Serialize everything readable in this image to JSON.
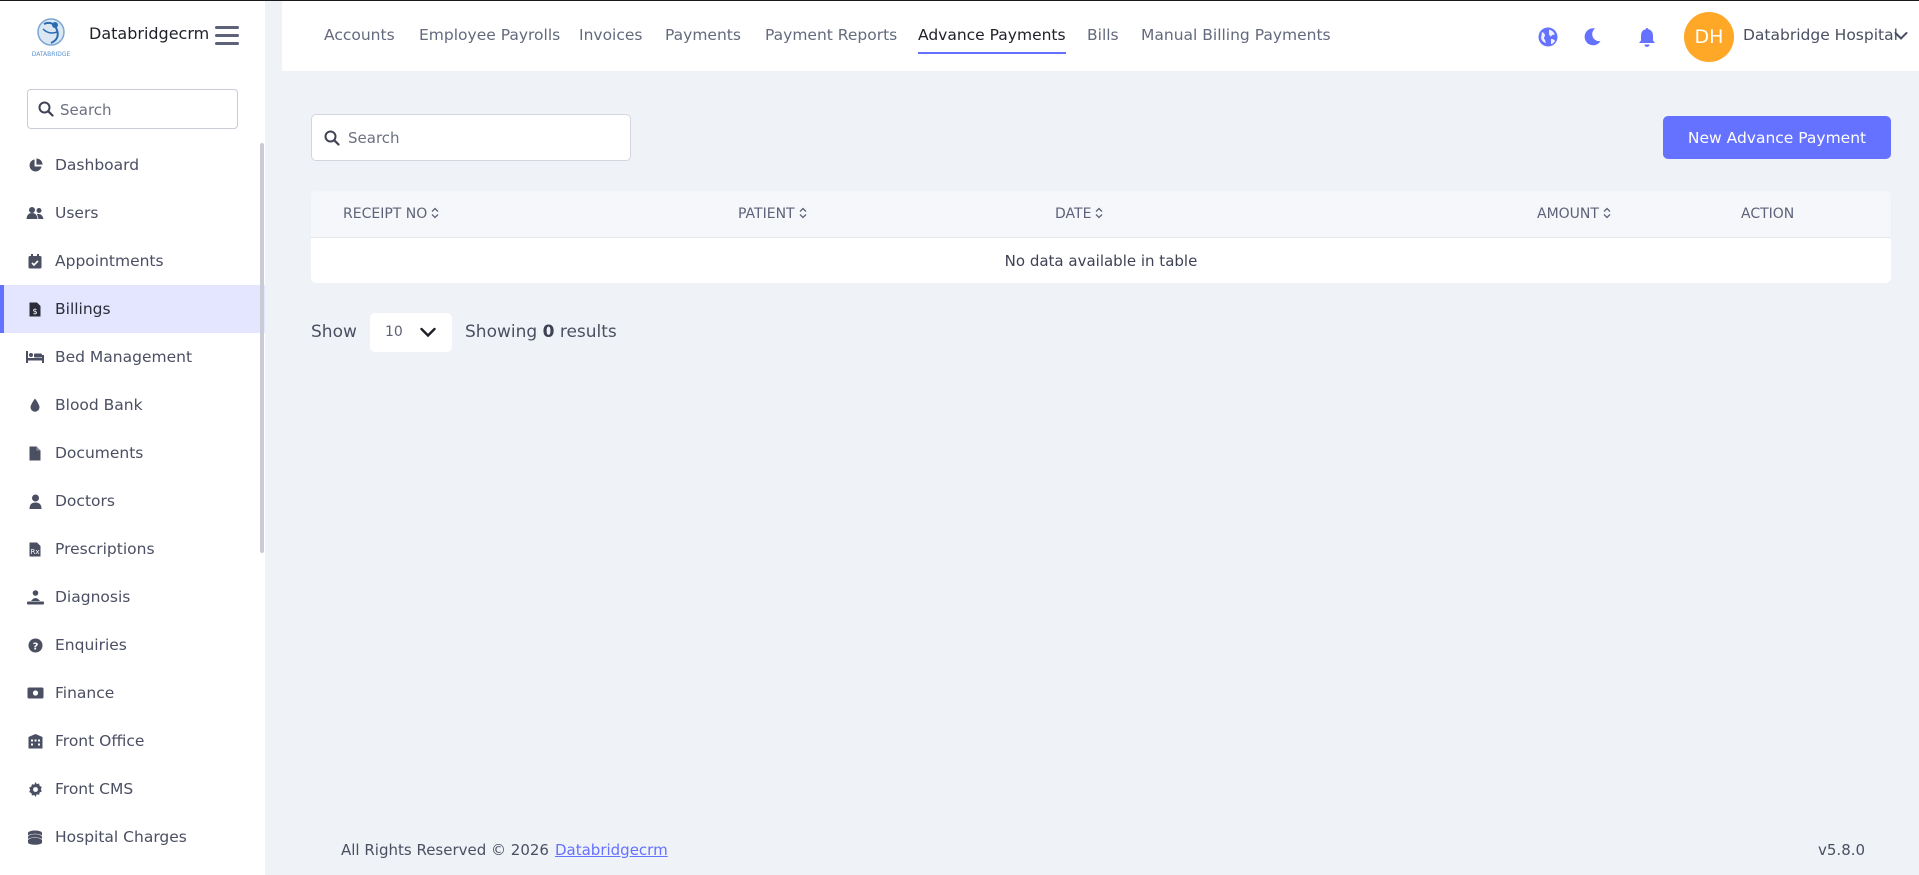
{
  "app": {
    "brand_name": "Databridgecrm",
    "logo_caption": "DATABRIDGE"
  },
  "sidebar": {
    "search_placeholder": "Search",
    "items": [
      {
        "label": "Dashboard",
        "icon": "pie-chart-icon"
      },
      {
        "label": "Users",
        "icon": "users-icon"
      },
      {
        "label": "Appointments",
        "icon": "calendar-check-icon"
      },
      {
        "label": "Billings",
        "icon": "file-invoice-icon",
        "active": true
      },
      {
        "label": "Bed Management",
        "icon": "bed-icon"
      },
      {
        "label": "Blood Bank",
        "icon": "droplet-icon"
      },
      {
        "label": "Documents",
        "icon": "file-icon"
      },
      {
        "label": "Doctors",
        "icon": "doctor-icon"
      },
      {
        "label": "Prescriptions",
        "icon": "prescription-icon"
      },
      {
        "label": "Diagnosis",
        "icon": "diagnosis-icon"
      },
      {
        "label": "Enquiries",
        "icon": "question-circle-icon"
      },
      {
        "label": "Finance",
        "icon": "money-icon"
      },
      {
        "label": "Front Office",
        "icon": "building-icon"
      },
      {
        "label": "Front CMS",
        "icon": "gear-icon"
      },
      {
        "label": "Hospital Charges",
        "icon": "coins-icon"
      }
    ]
  },
  "header": {
    "tabs": [
      {
        "label": "Accounts"
      },
      {
        "label": "Employee Payrolls"
      },
      {
        "label": "Invoices"
      },
      {
        "label": "Payments"
      },
      {
        "label": "Payment Reports"
      },
      {
        "label": "Advance Payments",
        "active": true
      },
      {
        "label": "Bills"
      },
      {
        "label": "Manual Billing Payments"
      }
    ],
    "avatar_initials": "DH",
    "user_name": "Databridge Hospital"
  },
  "main": {
    "search_placeholder": "Search",
    "new_button_label": "New Advance Payment",
    "table": {
      "columns": [
        "RECEIPT NO",
        "PATIENT",
        "DATE",
        "AMOUNT",
        "ACTION"
      ],
      "rows": [],
      "empty_message": "No data available in table"
    },
    "pagination": {
      "show_label": "Show",
      "page_size": "10",
      "showing_prefix": "Showing",
      "showing_count": "0",
      "showing_suffix": "results"
    }
  },
  "footer": {
    "copyright": "All Rights Reserved © 2026",
    "link_label": "Databridgecrm",
    "version": "v5.8.0"
  },
  "colors": {
    "accent": "#6571ff",
    "avatar_bg": "#ffa726",
    "page_bg": "#eff3f7",
    "active_menu_bg": "#e4e6ff"
  }
}
